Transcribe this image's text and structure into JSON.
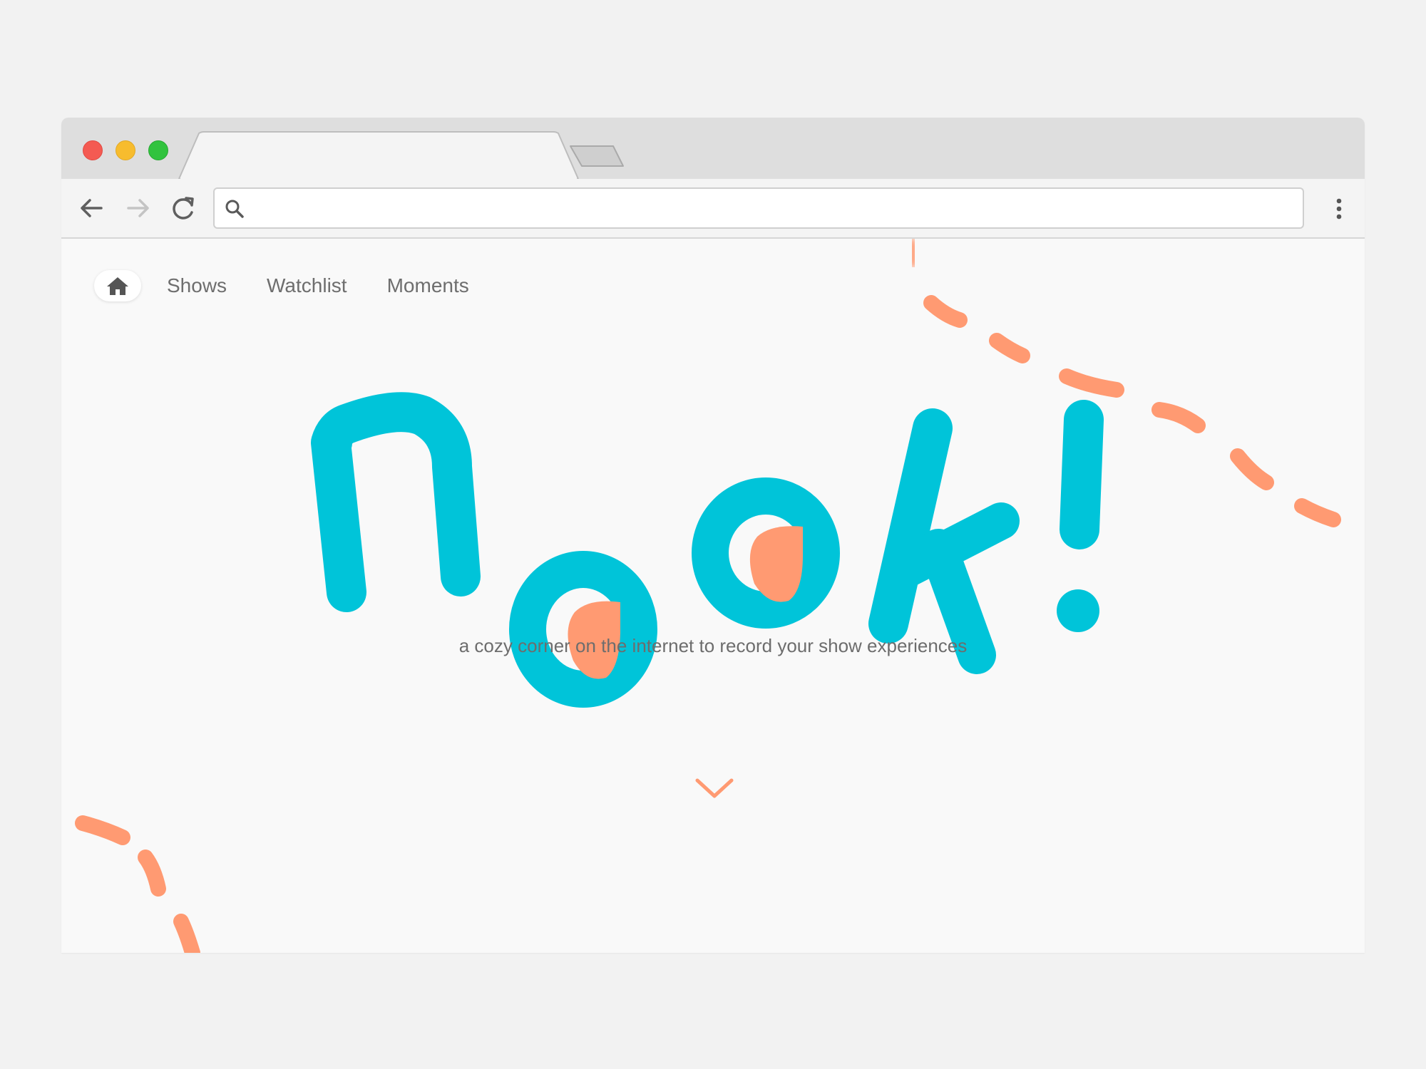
{
  "browser": {
    "tabs": [
      {
        "label": "",
        "active": true
      },
      {
        "label": "",
        "active": false
      }
    ],
    "address_bar": {
      "value": "",
      "placeholder": ""
    },
    "controls": {
      "back_icon": "arrow-left-icon",
      "forward_icon": "arrow-right-icon",
      "reload_icon": "reload-icon",
      "menu_icon": "kebab-menu-icon"
    }
  },
  "site": {
    "nav": {
      "home_icon": "house-icon",
      "links": [
        {
          "label": "Shows"
        },
        {
          "label": "Watchlist"
        },
        {
          "label": "Moments"
        }
      ]
    },
    "logo_text": "nook!",
    "tagline": "a cozy corner on the internet to record your show experiences",
    "scroll_icon": "chevron-down-icon"
  },
  "colors": {
    "logo_primary": "#00c4d9",
    "accent": "#ff9a72",
    "nav_text": "#6e6e6e",
    "page_bg": "#f9f9f9",
    "outer_bg": "#f2f2f2"
  }
}
